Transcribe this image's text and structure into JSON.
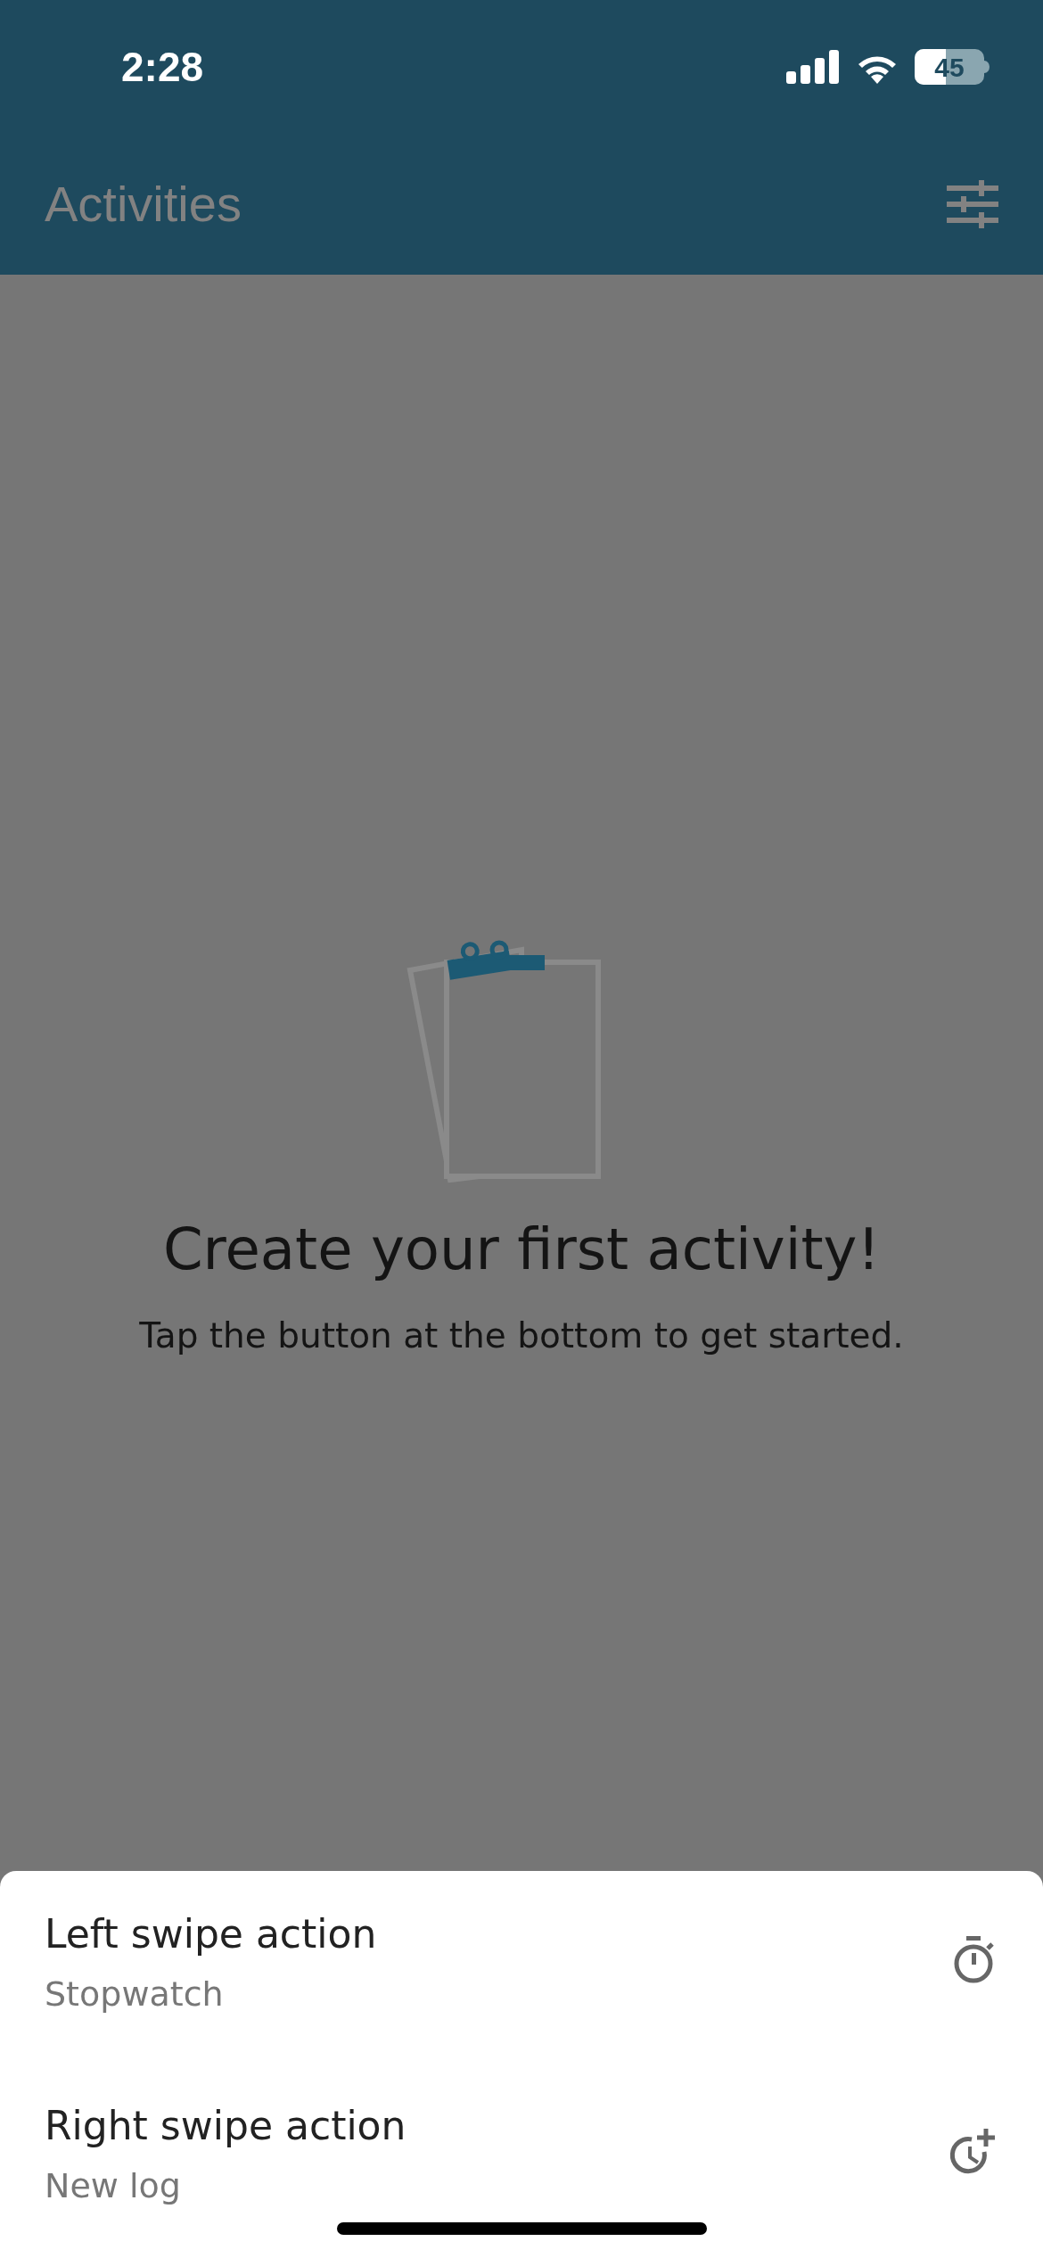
{
  "status_bar": {
    "time": "2:28",
    "battery": "45"
  },
  "header": {
    "title": "Activities"
  },
  "empty_state": {
    "title": "Create your first activity!",
    "message": "Tap the button at the bottom to get started."
  },
  "sheet": {
    "items": [
      {
        "kind": "stopwatch",
        "title": "Left swipe action",
        "value": "Stopwatch"
      },
      {
        "kind": "new-log",
        "title": "Right swipe action",
        "value": "New log"
      }
    ]
  }
}
